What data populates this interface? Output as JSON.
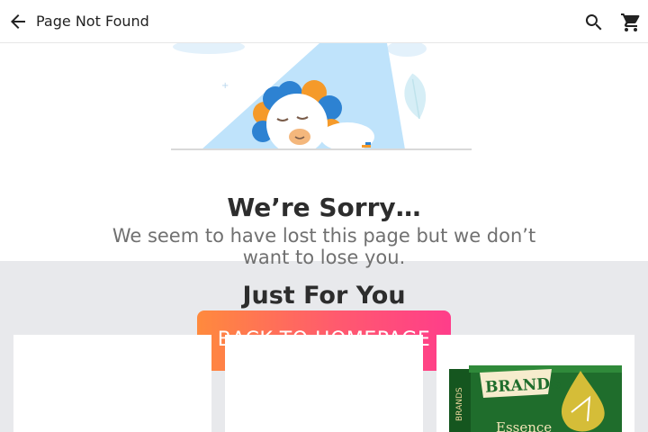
{
  "header": {
    "title": "Page Not Found",
    "back_icon": "arrow-left-icon",
    "search_icon": "search-icon",
    "cart_icon": "cart-icon"
  },
  "error": {
    "heading": "We’re Sorry…",
    "message": "We seem to have lost this page but we don’t want to lose you.",
    "button_label": "BACK TO HOMEPAGE"
  },
  "recommendations": {
    "heading": "Just For You",
    "products": [
      {
        "image": ""
      },
      {
        "image": ""
      },
      {
        "image": "brands-essence-box",
        "brand": "BRANDS",
        "name": "Essence"
      }
    ]
  },
  "colors": {
    "button_gradient_start": "#ff8a3d",
    "button_gradient_end": "#ff3d8a",
    "section_bg": "#e8e9ec",
    "product_green": "#1f6d2c"
  }
}
